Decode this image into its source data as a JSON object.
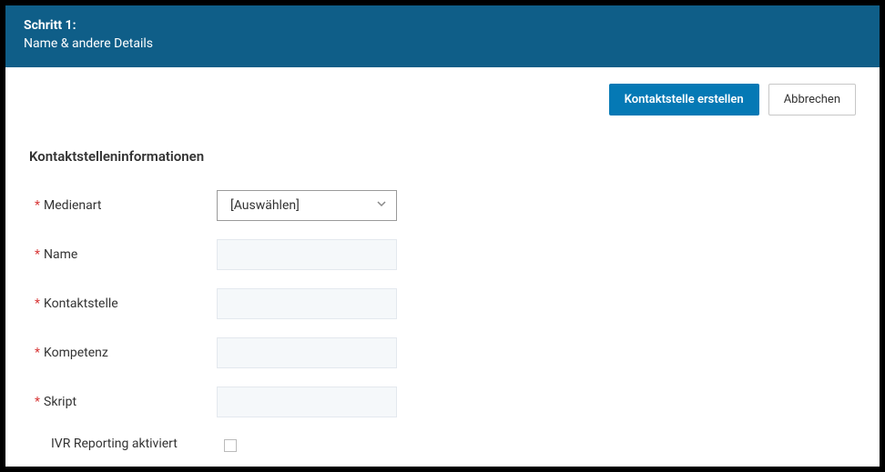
{
  "header": {
    "step": "Schritt 1:",
    "subtitle": "Name & andere Details"
  },
  "actions": {
    "create": "Kontaktstelle erstellen",
    "cancel": "Abbrechen"
  },
  "section": {
    "title": "Kontaktstelleninformationen"
  },
  "fields": {
    "media_type": {
      "label": "Medienart",
      "selected": "[Auswählen]"
    },
    "name": {
      "label": "Name",
      "value": ""
    },
    "contact_point": {
      "label": "Kontaktstelle",
      "value": ""
    },
    "skill": {
      "label": "Kompetenz",
      "value": ""
    },
    "script": {
      "label": "Skript",
      "value": ""
    },
    "ivr_reporting": {
      "label": "IVR Reporting aktiviert",
      "checked": false
    }
  }
}
